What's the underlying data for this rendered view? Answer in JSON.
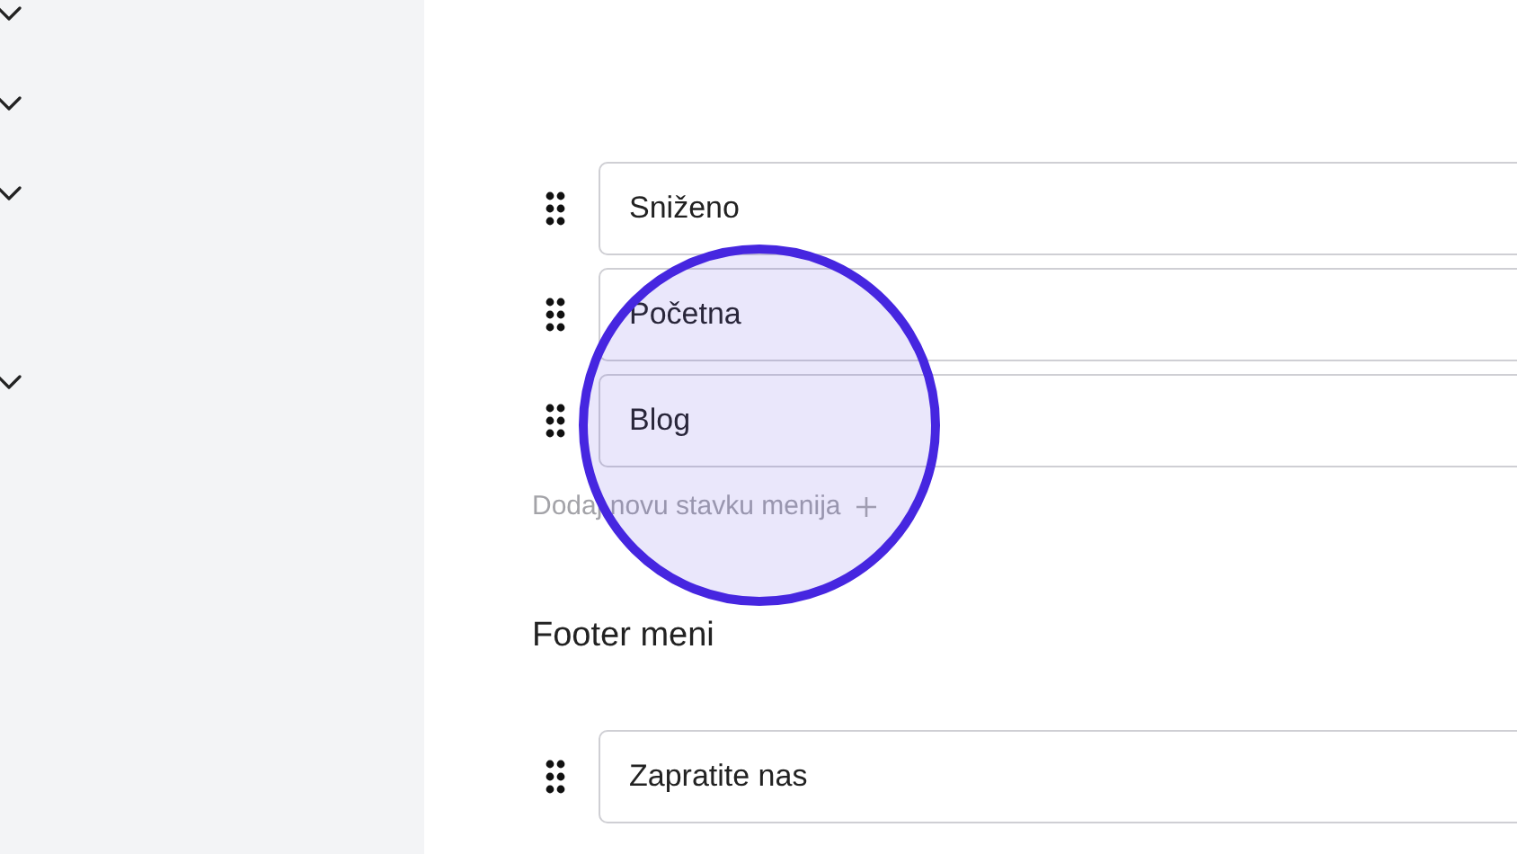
{
  "main_menu": {
    "items": [
      {
        "label": "Sniženo"
      },
      {
        "label": "Početna"
      },
      {
        "label": "Blog"
      }
    ],
    "add_item": {
      "label": "Dodaj novu stavku menija"
    }
  },
  "footer_menu": {
    "heading": "Footer meni",
    "items": [
      {
        "label": "Zapratite nas"
      }
    ]
  }
}
